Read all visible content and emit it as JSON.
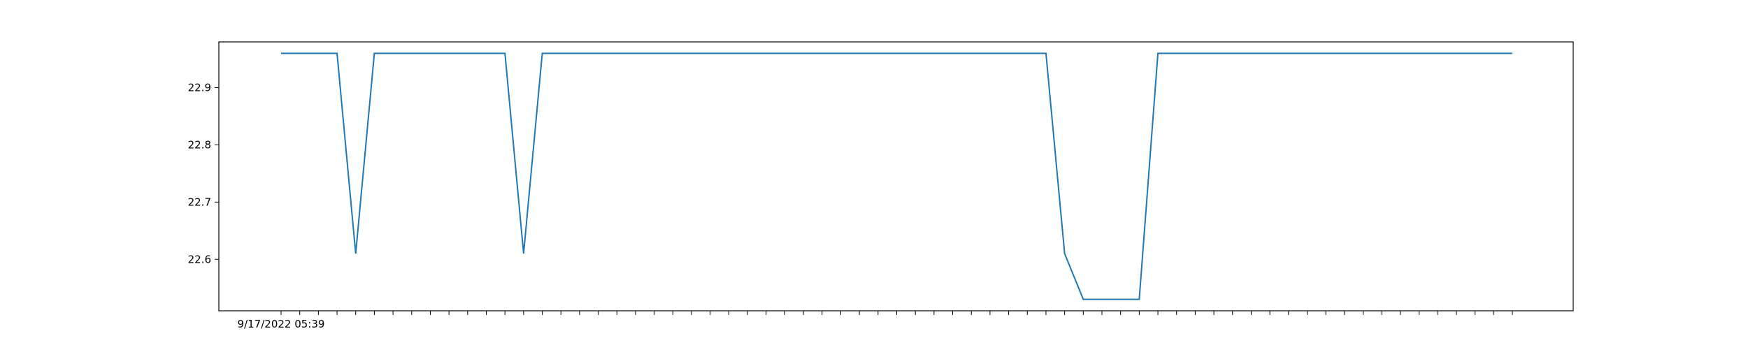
{
  "chart_data": {
    "type": "line",
    "title": "",
    "xlabel": "",
    "ylabel": "",
    "ylim": [
      22.51,
      22.98
    ],
    "yticks": [
      22.6,
      22.7,
      22.8,
      22.9
    ],
    "ytick_labels": [
      "22.6",
      "22.7",
      "22.8",
      "22.9"
    ],
    "x_first_label": "9/17/2022 05:39",
    "grid": false,
    "legend": "none",
    "series": [
      {
        "color": "#1f77b4",
        "values": [
          22.96,
          22.96,
          22.96,
          22.96,
          22.61,
          22.96,
          22.96,
          22.96,
          22.96,
          22.96,
          22.96,
          22.96,
          22.96,
          22.61,
          22.96,
          22.96,
          22.96,
          22.96,
          22.96,
          22.96,
          22.96,
          22.96,
          22.96,
          22.96,
          22.96,
          22.96,
          22.96,
          22.96,
          22.96,
          22.96,
          22.96,
          22.96,
          22.96,
          22.96,
          22.96,
          22.96,
          22.96,
          22.96,
          22.96,
          22.96,
          22.96,
          22.96,
          22.61,
          22.53,
          22.53,
          22.53,
          22.53,
          22.96,
          22.96,
          22.96,
          22.96,
          22.96,
          22.96,
          22.96,
          22.96,
          22.96,
          22.96,
          22.96,
          22.96,
          22.96,
          22.96,
          22.96,
          22.96,
          22.96,
          22.96,
          22.96,
          22.96
        ]
      }
    ]
  }
}
